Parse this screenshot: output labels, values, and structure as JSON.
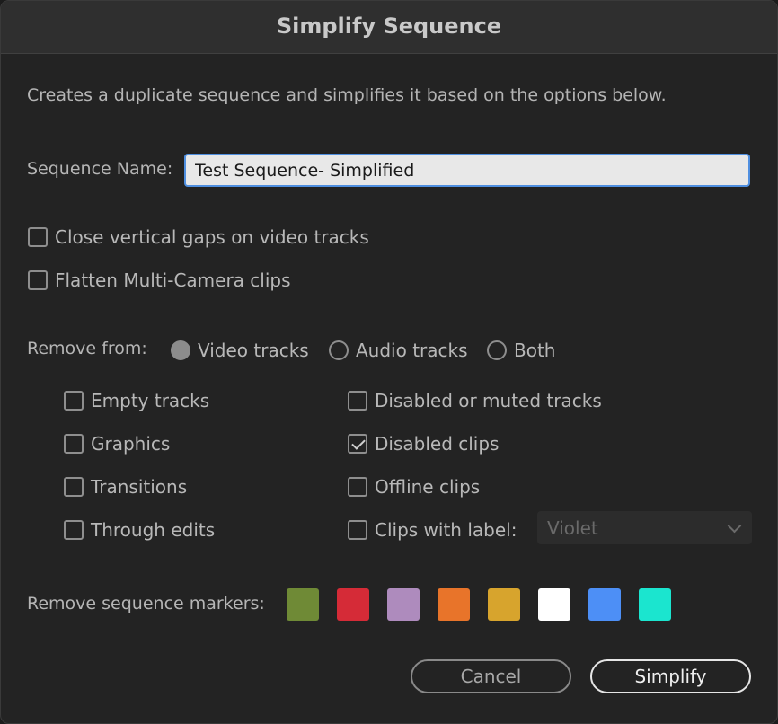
{
  "dialog": {
    "title": "Simplify Sequence",
    "description": "Creates a duplicate sequence and simplifies it based on the options below."
  },
  "sequence_name": {
    "label": "Sequence Name:",
    "value": "Test Sequence- Simplified"
  },
  "options": {
    "close_gaps": {
      "label": "Close vertical gaps on video tracks",
      "checked": false
    },
    "flatten_multicam": {
      "label": "Flatten Multi-Camera clips",
      "checked": false
    }
  },
  "remove_from": {
    "label": "Remove from:",
    "radios": [
      {
        "label": "Video tracks",
        "selected": true
      },
      {
        "label": "Audio tracks",
        "selected": false
      },
      {
        "label": "Both",
        "selected": false
      }
    ]
  },
  "remove_items": {
    "empty_tracks": {
      "label": "Empty tracks",
      "checked": false
    },
    "graphics": {
      "label": "Graphics",
      "checked": false
    },
    "transitions": {
      "label": "Transitions",
      "checked": false
    },
    "through_edits": {
      "label": "Through edits",
      "checked": false
    },
    "disabled_muted_tracks": {
      "label": "Disabled or muted tracks",
      "checked": false
    },
    "disabled_clips": {
      "label": "Disabled clips",
      "checked": true
    },
    "offline_clips": {
      "label": "Offline clips",
      "checked": false
    },
    "clips_with_label": {
      "label": "Clips with label:",
      "checked": false
    }
  },
  "label_select": {
    "value": "Violet",
    "icon": "chevron-down-icon"
  },
  "markers": {
    "label": "Remove sequence markers:",
    "colors": [
      "#6f8a36",
      "#d52b37",
      "#ae8bbd",
      "#e8742a",
      "#d7a42d",
      "#ffffff",
      "#4d8ff6",
      "#1be5cf"
    ]
  },
  "buttons": {
    "cancel": "Cancel",
    "simplify": "Simplify"
  }
}
